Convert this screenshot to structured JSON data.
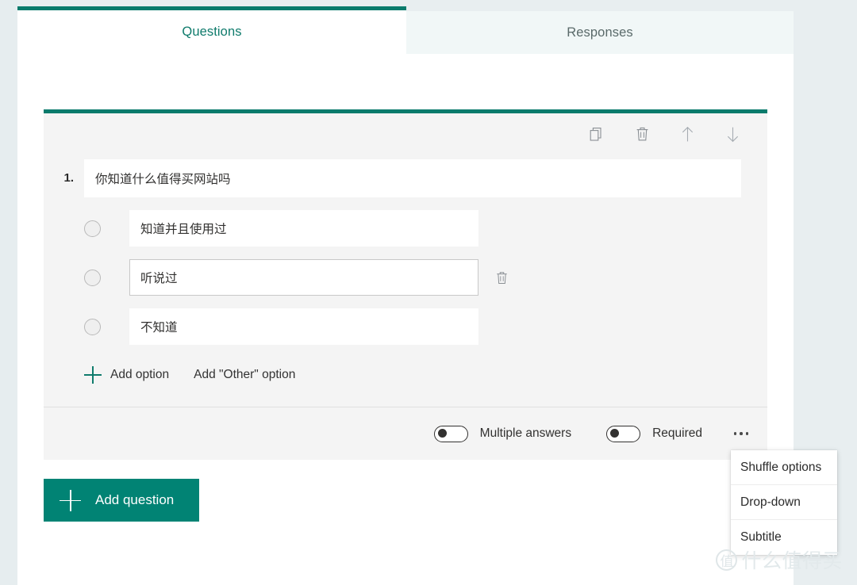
{
  "theme": {
    "accent_green": "#018374",
    "tab_green": "#0f7b6c",
    "card_bg": "#f4f4f4",
    "page_bg": "#e8eef0"
  },
  "tabs": [
    {
      "id": "questions",
      "label": "Questions",
      "selected": true
    },
    {
      "id": "responses",
      "label": "Responses",
      "selected": false
    }
  ],
  "question_card": {
    "number": "1.",
    "title": "你知道什么值得买网站吗",
    "toolbar": [
      {
        "name": "copy-icon",
        "label": "Copy question"
      },
      {
        "name": "delete-icon",
        "label": "Delete question"
      },
      {
        "name": "move-up-icon",
        "label": "Move question up"
      },
      {
        "name": "move-down-icon",
        "label": "Move question down"
      }
    ],
    "options": [
      {
        "text": "知道并且使用过",
        "active": false,
        "delete_icon": "delete-icon"
      },
      {
        "text": "听说过",
        "active": true,
        "delete_icon": "delete-icon"
      },
      {
        "text": "不知道",
        "active": false,
        "delete_icon": "delete-icon"
      }
    ],
    "add_option_label": "Add option",
    "add_other_option_label": "Add \"Other\" option",
    "footer": {
      "multiple_answers": {
        "label": "Multiple answers",
        "on": false
      },
      "required": {
        "label": "Required",
        "on": false
      },
      "more_icon": "ellipsis-icon"
    }
  },
  "context_menu": {
    "items": [
      {
        "label": "Shuffle options"
      },
      {
        "label": "Drop-down"
      },
      {
        "label": "Subtitle"
      }
    ]
  },
  "add_question": {
    "label": "Add question",
    "icon": "plus-icon"
  },
  "watermark": {
    "badge": "值",
    "text": "什么值得买"
  }
}
